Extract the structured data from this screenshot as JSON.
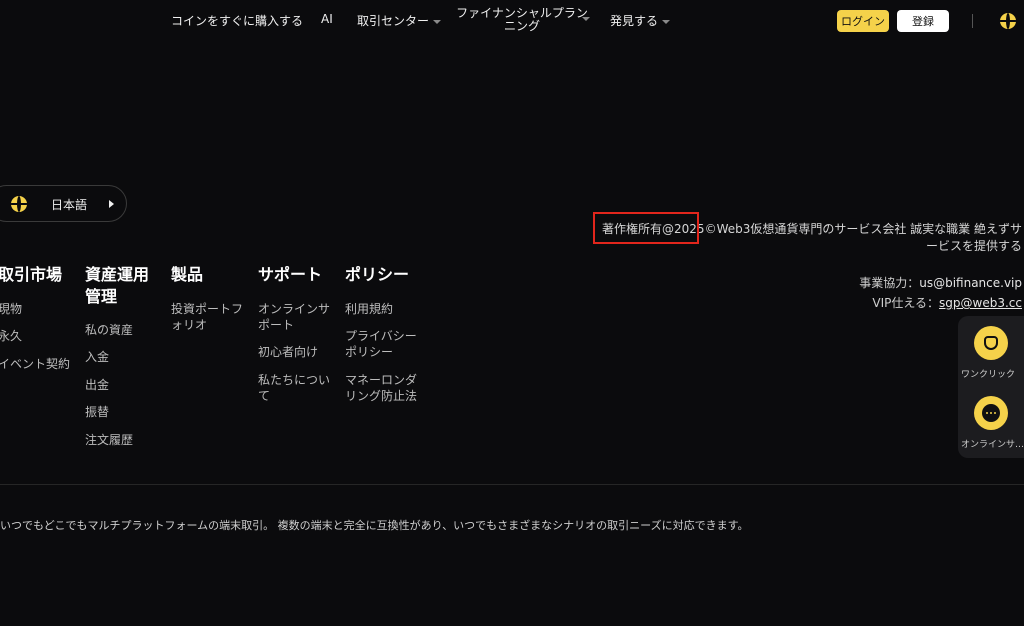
{
  "nav": {
    "items": [
      "コインをすぐに購入する",
      "AI",
      "取引センター",
      "ファイナンシャルプランニング",
      "発見する"
    ],
    "login_label": "ログイン",
    "register_label": "登録"
  },
  "language": {
    "label": "日本語"
  },
  "copyright": "著作権所有@2025©Web3仮想通貨専門のサービス会社 誠実な職業 絶えずサービスを提供する",
  "contact": {
    "business_label": "事業協力：",
    "business_email": "us@bifinance.vip",
    "vip_label": "VIP仕える：",
    "vip_email": "sgp@web3.cc"
  },
  "footer": {
    "columns": [
      {
        "title": "取引市場",
        "items": [
          "現物",
          "永久",
          "イベント契約"
        ]
      },
      {
        "title": "資産運用管理",
        "items": [
          "私の資産",
          "入金",
          "出金",
          "振替",
          "注文履歴"
        ]
      },
      {
        "title": "製品",
        "items": [
          "投資ポートフォリオ"
        ]
      },
      {
        "title": "サポート",
        "items": [
          "オンラインサポート",
          "初心者向け",
          "私たちについて"
        ]
      },
      {
        "title": "ポリシー",
        "items": [
          "利用規約",
          "プライバシーポリシー",
          "マネーロンダリング防止法"
        ]
      }
    ]
  },
  "bottom_text": "いつでもどこでもマルチプラットフォームの端末取引。 複数の端末と完全に互換性があり、いつでもさまざまなシナリオの取引ニーズに対応できます。",
  "floating": {
    "one_click_label": "ワンクリック",
    "online_label": "オンラインサービス"
  },
  "colors": {
    "accent": "#f5d24a",
    "background": "#0b0b0d",
    "highlight_box": "#e2261c"
  },
  "icons": [
    "globe-icon",
    "caret-down-icon",
    "caret-right-icon",
    "hand-icon",
    "chat-icon"
  ]
}
